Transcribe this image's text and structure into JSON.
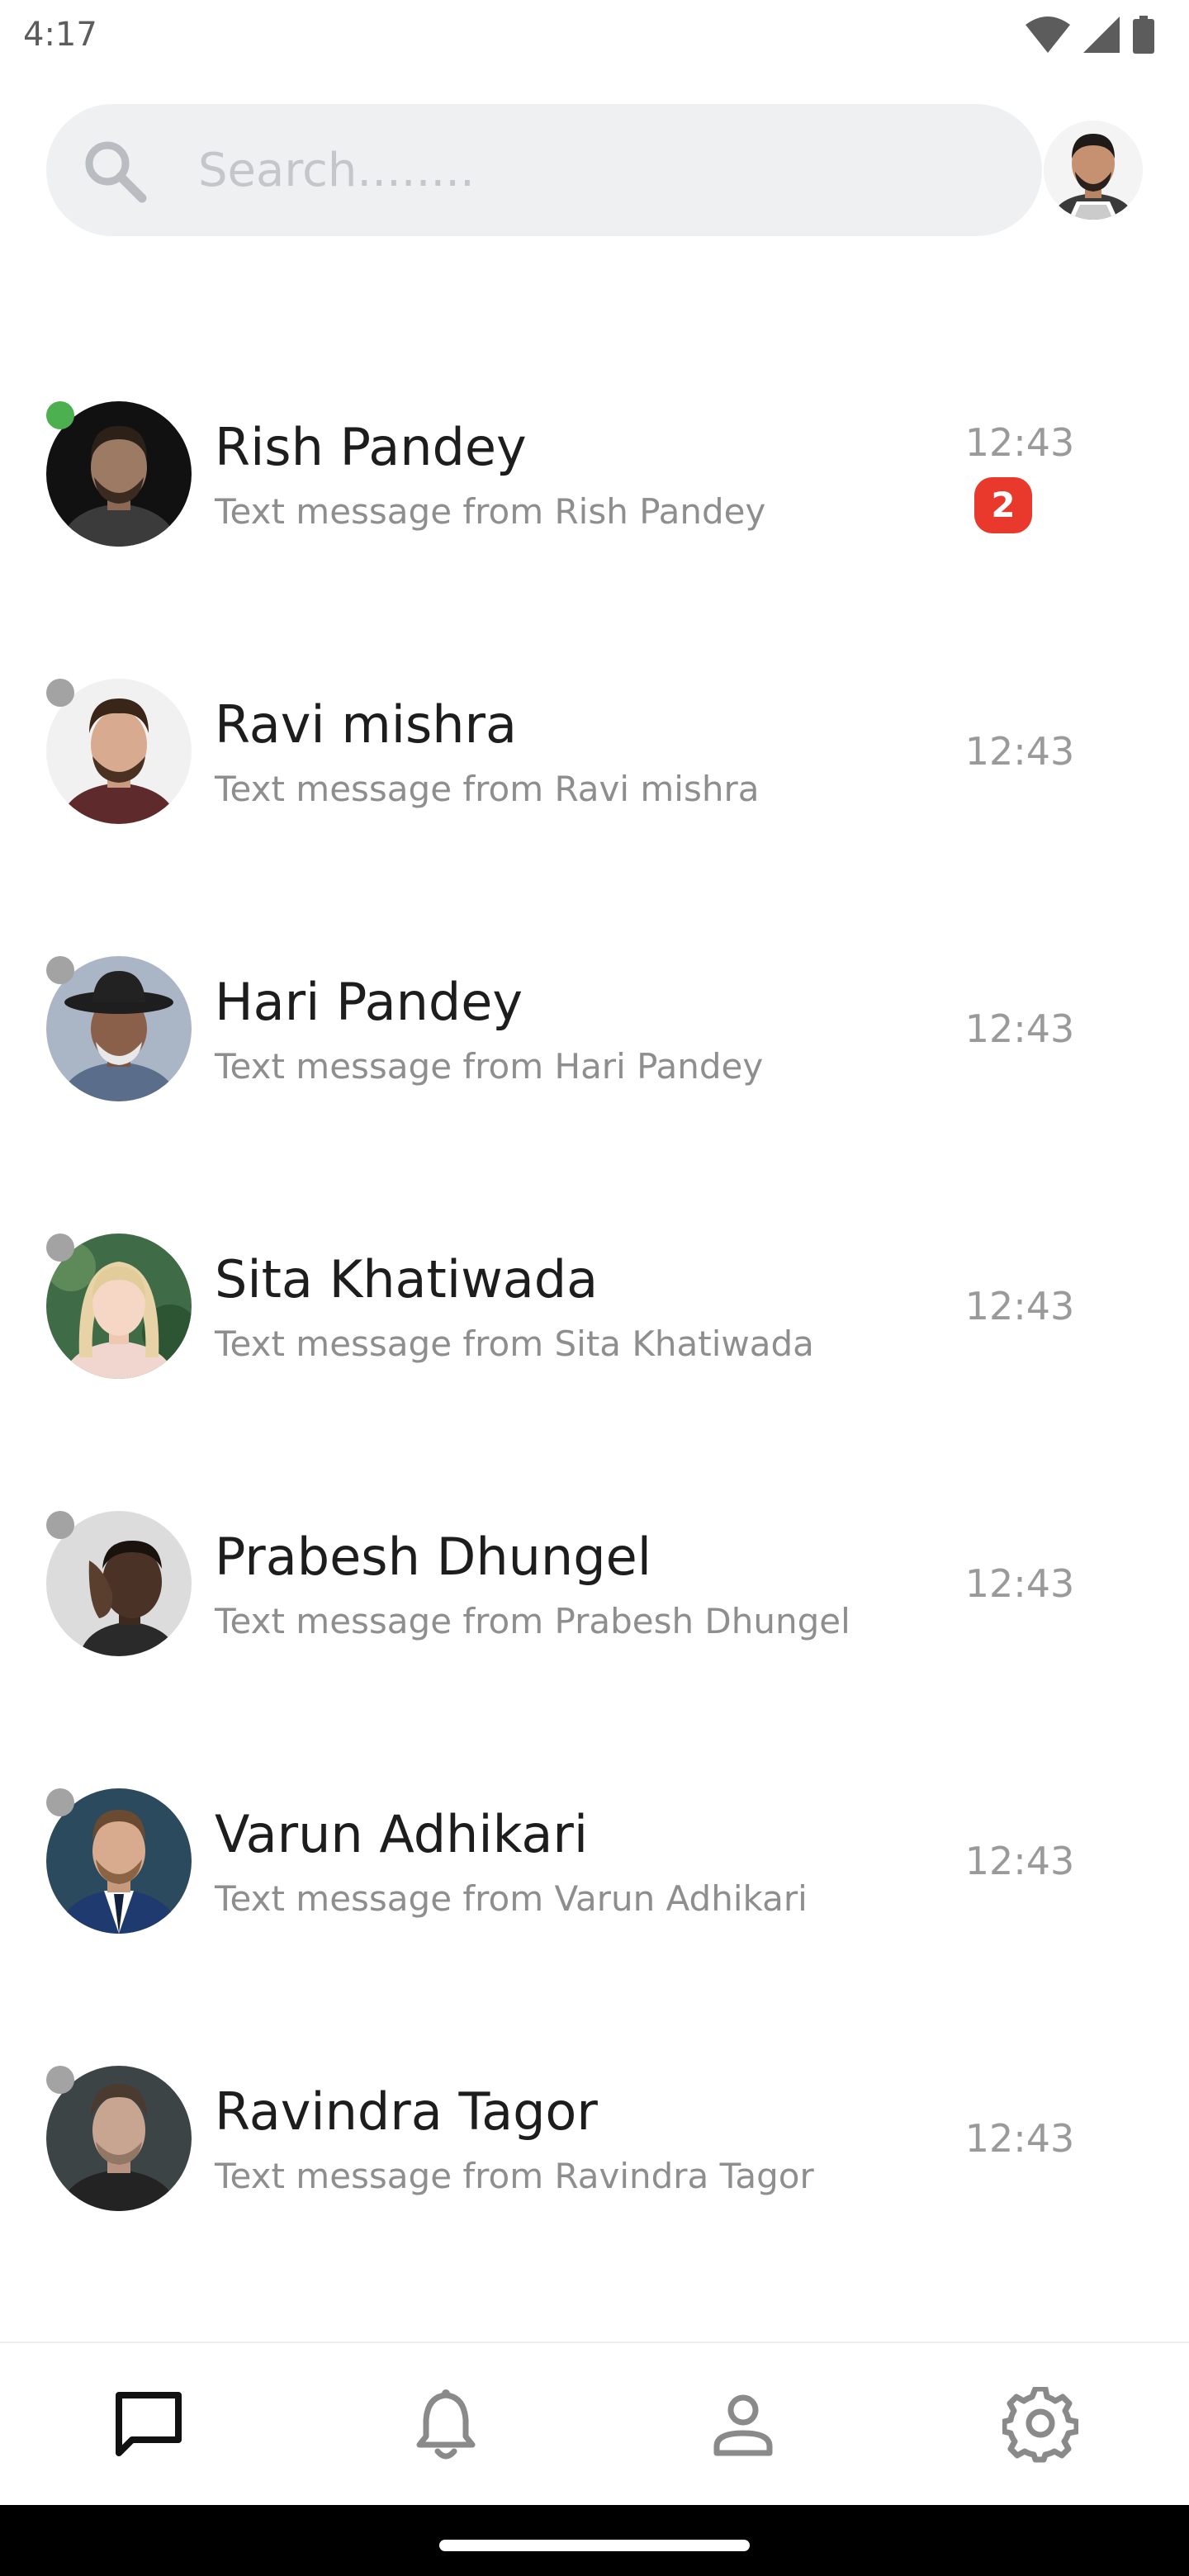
{
  "status_bar": {
    "time": "4:17",
    "icons": [
      "wifi-icon",
      "signal-icon",
      "battery-icon"
    ]
  },
  "search": {
    "placeholder": "Search........",
    "value": ""
  },
  "colors": {
    "online": "#4caf50",
    "offline": "#a3a3a3",
    "badge": "#e8392c",
    "search_bg": "#eef0f2"
  },
  "chats": [
    {
      "name": "Rish Pandey",
      "preview": "Text message from Rish Pandey",
      "time": "12:43",
      "unread": "2",
      "online": true
    },
    {
      "name": "Ravi mishra",
      "preview": "Text message from Ravi mishra",
      "time": "12:43",
      "unread": "",
      "online": false
    },
    {
      "name": "Hari Pandey",
      "preview": "Text message from Hari Pandey",
      "time": "12:43",
      "unread": "",
      "online": false
    },
    {
      "name": "Sita Khatiwada",
      "preview": "Text message from Sita Khatiwada",
      "time": "12:43",
      "unread": "",
      "online": false
    },
    {
      "name": "Prabesh Dhungel",
      "preview": "Text message from Prabesh Dhungel",
      "time": "12:43",
      "unread": "",
      "online": false
    },
    {
      "name": "Varun Adhikari",
      "preview": "Text message from Varun Adhikari",
      "time": "12:43",
      "unread": "",
      "online": false
    },
    {
      "name": "Ravindra Tagor",
      "preview": "Text message from Ravindra Tagor",
      "time": "12:43",
      "unread": "",
      "online": false
    }
  ],
  "bottom_nav": {
    "items": [
      {
        "icon": "chat-icon",
        "active": true
      },
      {
        "icon": "bell-icon",
        "active": false
      },
      {
        "icon": "person-icon",
        "active": false
      },
      {
        "icon": "gear-icon",
        "active": false
      }
    ]
  }
}
